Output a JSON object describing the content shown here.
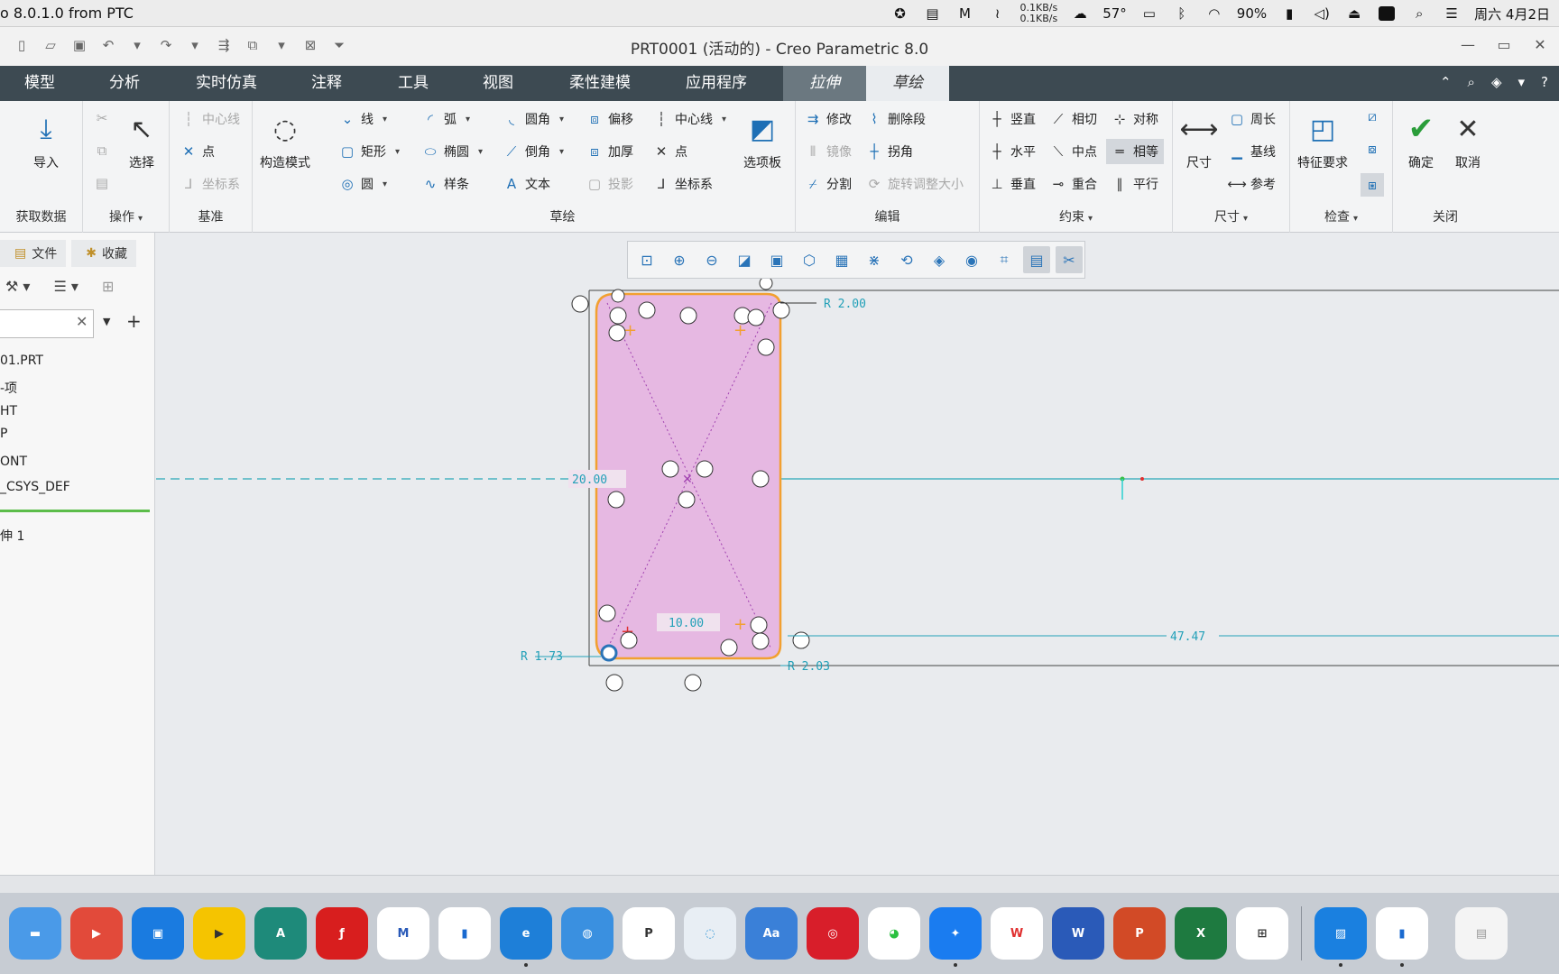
{
  "mac": {
    "app_title": "o 8.0.1.0 from PTC",
    "net_up": "0.1KB/s",
    "net_down": "0.1KB/s",
    "temp": "57°",
    "battery": "90%",
    "datetime": "周六 4月2日"
  },
  "window": {
    "title": "PRT0001 (活动的) - Creo Parametric 8.0"
  },
  "tabs": [
    "模型",
    "分析",
    "实时仿真",
    "注释",
    "工具",
    "视图",
    "柔性建模",
    "应用程序",
    "拉伸",
    "草绘"
  ],
  "ribbon": {
    "get_data": {
      "import": "导入",
      "group": "获取数据"
    },
    "ops": {
      "select": "选择",
      "group": "操作"
    },
    "datum": {
      "centerline": "中心线",
      "point": "点",
      "csys": "坐标系",
      "group": "基准"
    },
    "construct": {
      "label": "构造模式"
    },
    "sketch": {
      "line": "线",
      "rect": "矩形",
      "circle": "圆",
      "arc": "弧",
      "ellipse": "椭圆",
      "spline": "样条",
      "fillet": "圆角",
      "chamfer": "倒角",
      "text": "文本",
      "offset": "偏移",
      "thicken": "加厚",
      "project": "投影",
      "centerline": "中心线",
      "point": "点",
      "csys": "坐标系",
      "palette": "选项板",
      "group": "草绘"
    },
    "edit": {
      "modify": "修改",
      "delete_seg": "删除段",
      "mirror": "镜像",
      "corner": "拐角",
      "divide": "分割",
      "rotate_resize": "旋转调整大小",
      "group": "编辑"
    },
    "constrain": {
      "vertical": "竖直",
      "tangent": "相切",
      "symmetric": "对称",
      "horizontal": "水平",
      "midpoint": "中点",
      "equal": "相等",
      "perpendicular": "垂直",
      "coincident": "重合",
      "parallel": "平行",
      "group": "约束"
    },
    "dimension": {
      "dim": "尺寸",
      "perimeter": "周长",
      "baseline": "基线",
      "reference": "参考",
      "group": "尺寸"
    },
    "inspect": {
      "feature_req": "特征要求",
      "group": "检查"
    },
    "close": {
      "ok": "确定",
      "cancel": "取消",
      "group": "关闭"
    }
  },
  "left_panel": {
    "tab_files": "文件",
    "tab_fav": "收藏",
    "search_placeholder": "",
    "tree": [
      "01.PRT",
      "-项",
      "HT",
      "P",
      "ONT",
      "_CSYS_DEF",
      "伸 1"
    ]
  },
  "sketch_dims": {
    "r_top_right": "R 2.00",
    "height": "20.00",
    "width": "10.00",
    "r_bottom_left": "R 1.73",
    "r_bottom_right": "R 2.03",
    "offset": "47.47"
  },
  "dock": [
    "Finder",
    "Infuse",
    "Screens",
    "Player",
    "Autodesk",
    "Flash",
    "M",
    "Parallels",
    "Edge",
    "Globe",
    "Pitaya",
    "Loading",
    "Dictionary",
    "NetEase",
    "WeChat",
    "DingTalk",
    "WPS",
    "Word",
    "PowerPoint",
    "Excel",
    "Windows",
    "Preview",
    "Parallels2",
    "Screenshot"
  ],
  "colors": {
    "tab_bar": "#3d4a52",
    "sketch_fill": "#e6b8e2",
    "sketch_edge": "#f2a030",
    "dimension": "#22a0b8"
  }
}
